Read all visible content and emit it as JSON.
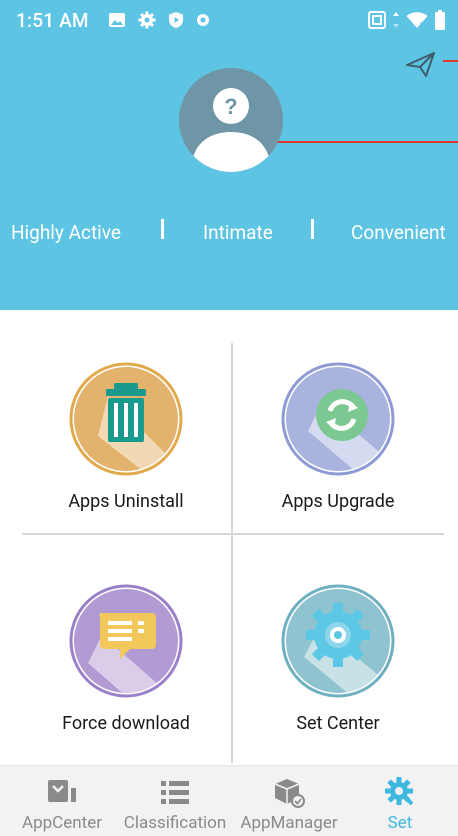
{
  "status_bar": {
    "time": "1:51 AM",
    "left_icons": [
      "image-icon",
      "gear-icon",
      "shield-play-icon",
      "record-icon"
    ],
    "right_icons": [
      "nfc-icon",
      "signal-arrows-icon",
      "wifi-icon",
      "battery-icon"
    ]
  },
  "header": {
    "background": "#5ec4e4",
    "avatar_icon": "user-unknown-avatar",
    "send_icon": "paper-plane-icon",
    "tags": [
      "Highly Active",
      "Intimate",
      "Convenient"
    ]
  },
  "tiles": [
    {
      "label": "Apps Uninstall",
      "icon": "trash-icon",
      "color": "#e3b36d",
      "ring": "#e0a94a"
    },
    {
      "label": "Apps Upgrade",
      "icon": "refresh-icon",
      "color": "#a9b4de",
      "ring": "#8e9ad6"
    },
    {
      "label": "Force download",
      "icon": "chat-download-icon",
      "color": "#b29ad3",
      "ring": "#9a80c8"
    },
    {
      "label": "Set Center",
      "icon": "gear-settings-icon",
      "color": "#8fc3cf",
      "ring": "#6eb0bf"
    }
  ],
  "bottom_nav": {
    "items": [
      {
        "label": "AppCenter",
        "icon": "app-center-icon"
      },
      {
        "label": "Classification",
        "icon": "list-icon"
      },
      {
        "label": "AppManager",
        "icon": "package-manager-icon"
      },
      {
        "label": "Set",
        "icon": "settings-gear-icon"
      }
    ],
    "active_index": 3,
    "active_color": "#3fb8e0",
    "inactive_color": "#8a8a8a"
  }
}
